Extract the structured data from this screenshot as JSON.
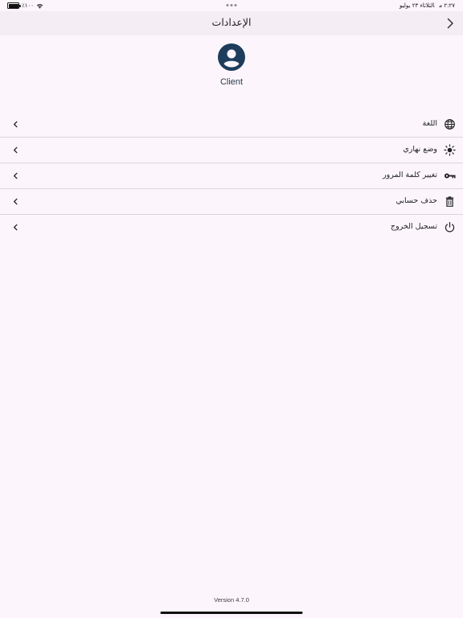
{
  "status_bar": {
    "time": "٢:٢٧ م",
    "date": "الثلاثاء ٢٣ يوليو",
    "battery": "٪١٠٠",
    "battery_level": 1.0
  },
  "header": {
    "title": "الإعدادات"
  },
  "profile": {
    "name": "Client"
  },
  "settings": {
    "items": [
      {
        "label": "اللغة",
        "icon": "globe-icon"
      },
      {
        "label": "وضع نهاري",
        "icon": "sun-icon"
      },
      {
        "label": "تغيير كلمة المرور",
        "icon": "key-icon"
      },
      {
        "label": "حذف حسابي",
        "icon": "trash-icon"
      },
      {
        "label": "تسجيل الخروج",
        "icon": "power-icon"
      }
    ]
  },
  "footer": {
    "version": "Version 4.7.0"
  },
  "colors": {
    "background": "#fcf6fc",
    "header_background": "#f4eef4",
    "avatar": "#1e3d5c",
    "divider": "#dcd6dc"
  }
}
